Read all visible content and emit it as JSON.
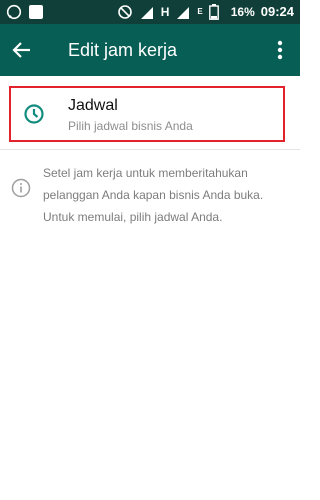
{
  "status_bar": {
    "time": "09:24",
    "battery": "16%",
    "network_label": "H",
    "network_label2": "E"
  },
  "app_bar": {
    "title": "Edit jam kerja"
  },
  "schedule": {
    "title": "Jadwal",
    "subtitle": "Pilih jadwal bisnis Anda"
  },
  "info": {
    "text": "Setel jam kerja untuk memberitahukan pelanggan Anda kapan bisnis Anda buka. Untuk memulai, pilih jadwal Anda."
  },
  "colors": {
    "status_bar": "#0f3f38",
    "app_bar": "#075e54",
    "accent": "#128c7e",
    "highlight_border": "#e3232b"
  }
}
